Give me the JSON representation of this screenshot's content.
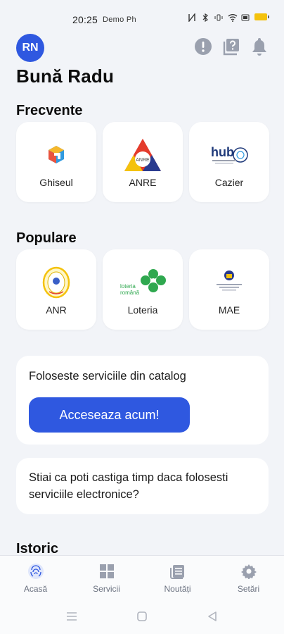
{
  "status_bar": {
    "time": "20:25",
    "carrier": "Demo Ph"
  },
  "header": {
    "avatar_initials": "RN",
    "greeting": "Bună Radu",
    "icons": [
      "alert-icon",
      "help-icon",
      "bell-icon"
    ]
  },
  "frequent": {
    "title": "Frecvente",
    "items": [
      {
        "label": "Ghiseul",
        "icon": "ghiseul-logo"
      },
      {
        "label": "ANRE",
        "icon": "anre-logo",
        "logo_text": "ANRE"
      },
      {
        "label": "Cazier",
        "icon": "hub-logo",
        "logo_text": "hub"
      }
    ]
  },
  "popular": {
    "title": "Populare",
    "items": [
      {
        "label": "ANR",
        "icon": "anr-logo"
      },
      {
        "label": "Loteria",
        "icon": "loteria-logo",
        "logo_text_1": "loteria",
        "logo_text_2": "română"
      },
      {
        "label": "MAE",
        "icon": "mae-logo"
      }
    ]
  },
  "catalog_card": {
    "text": "Foloseste serviciile din catalog",
    "button_label": "Acceseaza acum!"
  },
  "tip_card": {
    "text": "Stiai ca poti castiga timp daca folosesti serviciile electronice?"
  },
  "history": {
    "title": "Istoric"
  },
  "bottom_nav": {
    "items": [
      {
        "label": "Acasă",
        "icon": "home-fingerprint-icon",
        "active": true
      },
      {
        "label": "Servicii",
        "icon": "grid-icon",
        "active": false
      },
      {
        "label": "Noutăți",
        "icon": "news-icon",
        "active": false
      },
      {
        "label": "Setări",
        "icon": "gear-icon",
        "active": false
      }
    ]
  },
  "colors": {
    "accent": "#2f58e0",
    "background": "#f2f4f8",
    "icon_gray": "#9aa0ae"
  }
}
